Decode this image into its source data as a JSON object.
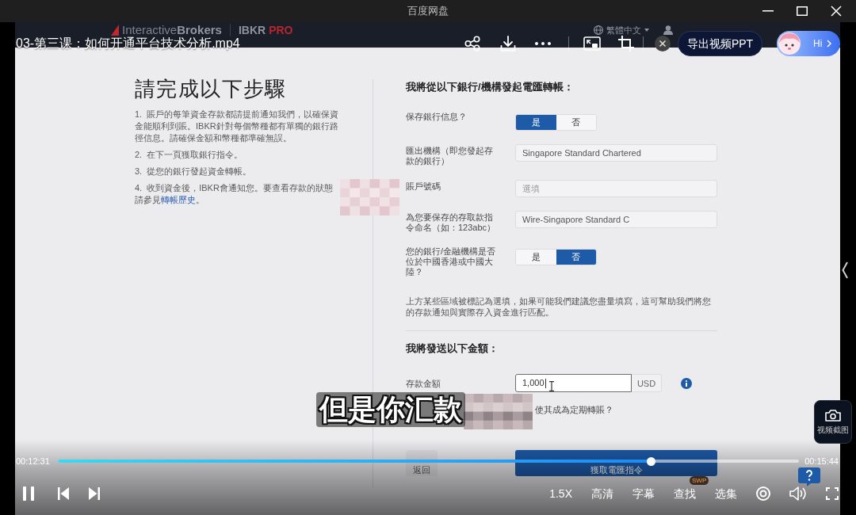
{
  "window": {
    "title": "百度网盘"
  },
  "player": {
    "title": "03-第三课：如何开通平台技术分析.mp4",
    "export_button": "导出视频PPT",
    "assistant": {
      "greeting": "Hi"
    },
    "screenshot_button": "视频截图",
    "playing": true,
    "current_time": "00:12:31",
    "total_time": "00:15:44",
    "progress": {
      "level": 0.8
    },
    "options": [
      {
        "label": "1.5X"
      },
      {
        "label": "高清"
      },
      {
        "label": "字幕"
      },
      {
        "label": "查找",
        "badge": "SWP"
      },
      {
        "label": "选集"
      }
    ]
  },
  "video_frame": {
    "site_header": {
      "logo": "Interactive**Brokers**",
      "product": "IBKR",
      "product_tier": "PRO",
      "language": "繁體中文"
    },
    "steps_title": "請完成以下步驟",
    "steps": [
      {
        "text": "1. 賬戶的每筆資金存款都請提前通知我們，以確保資金能順利到賬。IBKR針對每個幣種都有單獨的銀行路徑信息。請確保金額和幣種都準確無誤。"
      },
      {
        "text": "2. 在下一頁獲取銀行指令。"
      },
      {
        "text": "3. 從您的銀行發起資金轉帳。"
      },
      {
        "text": "4. 收到資金後，IBKR會通知您。要查看存款的狀態請參見",
        "link": "轉帳歷史",
        "after": "。"
      }
    ],
    "form": {
      "title": "我將從以下銀行/機構發起電匯轉帳：",
      "fields": [
        {
          "kind": "toggle",
          "label": "保存銀行信息？",
          "options": [
            {
              "label": "是",
              "selected": true
            },
            {
              "label": "否",
              "selected": false
            }
          ]
        },
        {
          "kind": "text",
          "label": "匯出機構（即您發起存款的銀行）",
          "value": "Singapore Standard Chartered"
        },
        {
          "kind": "text",
          "label": "賬戶號碼",
          "placeholder": "選填"
        },
        {
          "kind": "text",
          "label": "為您要保存的存取款指令命名（如：123abc）",
          "value": "Wire-Singapore Standard C"
        },
        {
          "kind": "toggle",
          "label": "您的銀行/金融機構是否位於中國香港或中國大陸？",
          "options": [
            {
              "label": "是",
              "selected": false
            },
            {
              "label": "否",
              "selected": true
            }
          ]
        }
      ],
      "note": "上方某些區域被標記為選填，如果可能我們建議您盡量填寫，這可幫助我們將您的存款通知與實際存入資金進行匹配。",
      "amount_title": "我將發送以下金額：",
      "amount": {
        "label": "存款金額",
        "value": "1,000",
        "currency": "USD",
        "focused": true
      },
      "recurring_label": "使其成為定期轉賬？",
      "buttons": [
        {
          "label": "返回",
          "kind": "secondary"
        },
        {
          "label": "獲取電匯指令",
          "kind": "primary"
        }
      ]
    },
    "subtitle": "但是你汇款"
  }
}
